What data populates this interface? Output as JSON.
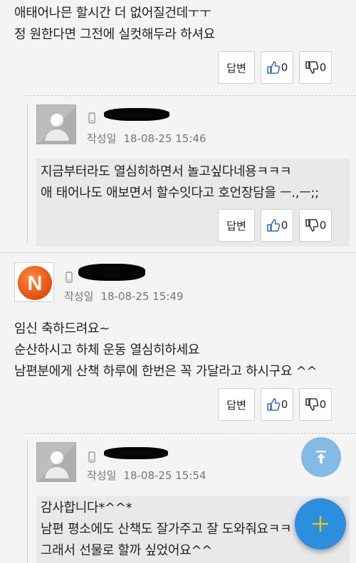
{
  "buttons": {
    "reply_label": "답변",
    "like_count": "0",
    "dislike_count": "0"
  },
  "comment0": {
    "lines": [
      "애태어나믄 할시간 더 없어질건데ㅜㅜ",
      "정 원한다면 그전에 실컷해두라 하셔요"
    ]
  },
  "reply1": {
    "date_label": "작성일",
    "date": "18-08-25 15:46",
    "lines": [
      "지금부터라도 열심히하면서 놀고싶다네용ㅋㅋㅋ",
      "애 태어나도 애보면서 할수잇다고 호언장담을 ㅡ.,ㅡ;;"
    ]
  },
  "comment2": {
    "avatar_letter": "N",
    "date_label": "작성일",
    "date": "18-08-25 15:49",
    "lines": [
      "임신 축하드려요~",
      "순산하시고 하체 운동 열심히하세요",
      "남편분에게 산책 하루에 한번은 꼭 가달라고 하시구요 ^^"
    ]
  },
  "reply3": {
    "date_label": "작성일",
    "date": "18-08-25 15:54",
    "lines": [
      "감사합니다*^^*",
      "남편 평소에도 산책도 잘가주고 잘 도와줘요ㅋㅋ",
      "그래서 선물로 할까 싶었어요^^"
    ]
  },
  "colors": {
    "background": "#f4f4f4",
    "reply_box": "#e9e9e9",
    "fab_top": "#7fb7e3",
    "fab_add": "#2b8fde",
    "fab_add_icon": "#f2c200",
    "icon_blue": "#3a6fb5",
    "n_avatar": "#f26522"
  },
  "icons": {
    "like": "thumbs-up-icon",
    "dislike": "thumbs-down-icon",
    "phone": "mobile-phone-icon",
    "scroll_top": "scroll-top-icon",
    "add": "plus-icon"
  }
}
